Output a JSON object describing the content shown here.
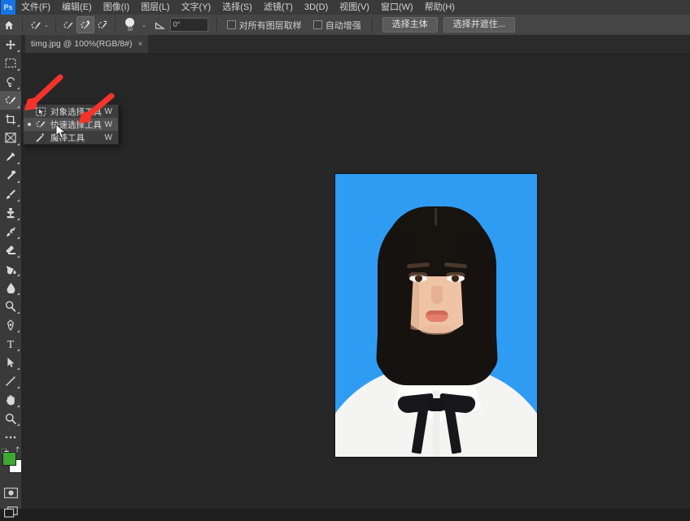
{
  "app": {
    "name": "Adobe Photoshop",
    "logo_text": "Ps",
    "accent_color": "#1473e6",
    "ui_bg": "#232323"
  },
  "menubar": {
    "items": [
      {
        "label": "文件(F)"
      },
      {
        "label": "编辑(E)"
      },
      {
        "label": "图像(I)"
      },
      {
        "label": "图层(L)"
      },
      {
        "label": "文字(Y)"
      },
      {
        "label": "选择(S)"
      },
      {
        "label": "滤镜(T)"
      },
      {
        "label": "3D(D)"
      },
      {
        "label": "视图(V)"
      },
      {
        "label": "窗口(W)"
      },
      {
        "label": "帮助(H)"
      }
    ]
  },
  "options_bar": {
    "home_icon": "home-icon",
    "tool_preset_icon": "quick-selection-preset-icon",
    "tool_preset_caret": "⌄",
    "modes": [
      {
        "name": "new-selection",
        "icon": "quick-selection-new-icon",
        "active": false
      },
      {
        "name": "add-to-selection",
        "icon": "quick-selection-add-icon",
        "active": true
      },
      {
        "name": "subtract-from-selection",
        "icon": "quick-selection-subtract-icon",
        "active": false
      }
    ],
    "brush_size": "30",
    "brush_caret": "⌄",
    "angle_icon": "angle-icon",
    "angle_value": "0°",
    "sample_all_layers": {
      "label": "对所有图层取样",
      "checked": false
    },
    "auto_enhance": {
      "label": "自动增强",
      "checked": false
    },
    "select_subject_button": "选择主体",
    "select_and_mask_button": "选择并遮住..."
  },
  "tab_bar": {
    "tabs": [
      {
        "title": "timg.jpg @ 100%(RGB/8#)",
        "close": "×",
        "active": true
      }
    ]
  },
  "toolbar": {
    "items": [
      {
        "name": "move-tool",
        "icon": "move-icon",
        "selected": false
      },
      {
        "name": "rectangular-marquee-tool",
        "icon": "marquee-icon",
        "selected": false
      },
      {
        "name": "lasso-tool",
        "icon": "lasso-icon",
        "selected": false
      },
      {
        "name": "quick-selection-tool",
        "icon": "quick-selection-icon",
        "selected": true
      },
      {
        "name": "crop-tool",
        "icon": "crop-icon",
        "selected": false
      },
      {
        "name": "frame-tool",
        "icon": "frame-icon",
        "selected": false
      },
      {
        "name": "eyedropper-tool",
        "icon": "eyedropper-icon",
        "selected": false
      },
      {
        "name": "healing-brush-tool",
        "icon": "healing-brush-icon",
        "selected": false
      },
      {
        "name": "brush-tool",
        "icon": "brush-icon",
        "selected": false
      },
      {
        "name": "clone-stamp-tool",
        "icon": "clone-stamp-icon",
        "selected": false
      },
      {
        "name": "history-brush-tool",
        "icon": "history-brush-icon",
        "selected": false
      },
      {
        "name": "eraser-tool",
        "icon": "eraser-icon",
        "selected": false
      },
      {
        "name": "gradient-tool",
        "icon": "paint-bucket-icon",
        "selected": false
      },
      {
        "name": "blur-tool",
        "icon": "blur-drop-icon",
        "selected": false
      },
      {
        "name": "dodge-tool",
        "icon": "dodge-icon",
        "selected": false
      },
      {
        "name": "pen-tool",
        "icon": "pen-icon",
        "selected": false
      },
      {
        "name": "type-tool",
        "icon": "type-t-icon",
        "selected": false
      },
      {
        "name": "path-selection-tool",
        "icon": "path-arrow-icon",
        "selected": false
      },
      {
        "name": "line-shape-tool",
        "icon": "line-icon",
        "selected": false
      },
      {
        "name": "hand-tool",
        "icon": "hand-icon",
        "selected": false
      },
      {
        "name": "zoom-tool",
        "icon": "magnifier-icon",
        "selected": false
      },
      {
        "name": "edit-toolbar",
        "icon": "ellipsis-icon",
        "selected": false
      }
    ],
    "colors": {
      "foreground": "#3ca832",
      "background": "#ffffff",
      "default_colors_icon": "default-colors-icon",
      "swap_colors_icon": "swap-colors-icon"
    },
    "bottom": [
      {
        "name": "quick-mask-button",
        "icon": "quick-mask-icon"
      },
      {
        "name": "screen-mode-button",
        "icon": "screen-mode-icon"
      }
    ]
  },
  "flyout_menu": {
    "items": [
      {
        "label": "对象选择工具",
        "shortcut": "W",
        "icon": "object-selection-icon",
        "selected": false,
        "highlighted": false
      },
      {
        "label": "快速选择工具",
        "shortcut": "W",
        "icon": "quick-selection-icon",
        "selected": true,
        "highlighted": true
      },
      {
        "label": "魔棒工具",
        "shortcut": "W",
        "icon": "magic-wand-icon",
        "selected": false,
        "highlighted": false
      }
    ]
  },
  "canvas": {
    "background_color": "#262626",
    "document": {
      "name": "timg.jpg",
      "zoom": "100%",
      "photo_background_color": "#2f9cf4",
      "description": "证件照：蓝底白衬衫黑色蝴蝶结女性肖像"
    }
  },
  "annotations": {
    "arrows": [
      {
        "name": "arrow-to-toolbar",
        "color": "#f4342b"
      },
      {
        "name": "arrow-to-quick-selection-menu-item",
        "color": "#f4342b"
      }
    ],
    "cursor": {
      "name": "mouse-cursor",
      "color": "#ffffff"
    }
  }
}
